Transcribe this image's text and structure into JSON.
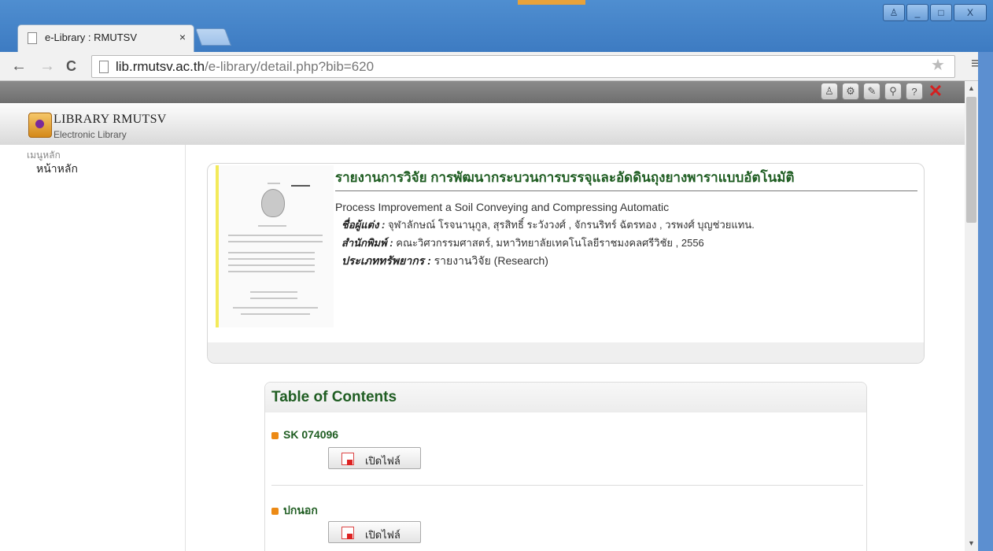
{
  "browser": {
    "tab_title": "e-Library : RMUTSV",
    "tab_close": "×",
    "url_host": "lib.rmutsv.ac.th",
    "url_path": "/e-library/detail.php?bib=620",
    "nav_back": "←",
    "nav_forward": "→",
    "nav_reload": "C",
    "star": "★",
    "menu": "≡",
    "win_user": "♙",
    "win_min": "_",
    "win_max": "□",
    "win_close": "X"
  },
  "toolbar_icons": {
    "user": "♙",
    "settings": "⚙",
    "edit": "✎",
    "users": "⚲",
    "help": "?",
    "close": "✕"
  },
  "header": {
    "title": "LIBRARY RMUTSV",
    "subtitle": "Electronic Library"
  },
  "sidebar": {
    "heading": "เมนูหลัก",
    "item": "หน้าหลัก"
  },
  "book": {
    "title": "รายงานการวิจัย การพัฒนากระบวนการบรรจุและอัดดินถุงยางพาราแบบอัตโนมัติ",
    "english_title": "Process Improvement a Soil Conveying and Compressing Automatic",
    "author_label": "ชื่อผู้แต่ง :",
    "authors": "จุฬาลักษณ์ โรจนานุกูล, สุรสิทธิ์ ระวังวงศ์ , จักรนริทร์ ฉัตรทอง , วรพงศ์ บุญช่วยแทน.",
    "publisher_label": "สำนักพิมพ์ :",
    "publisher": "คณะวิศวกรรมศาสตร์, มหาวิทยาลัยเทคโนโลยีราชมงคลศรีวิชัย , 2556",
    "type_label": "ประเภททรัพยากร :",
    "type": "รายงานวิจัย (Research)"
  },
  "toc": {
    "title": "Table of Contents",
    "items": [
      {
        "label": "SK 074096",
        "button": "เปิดไฟล์"
      },
      {
        "label": "ปกนอก",
        "button": "เปิดไฟล์"
      }
    ]
  }
}
